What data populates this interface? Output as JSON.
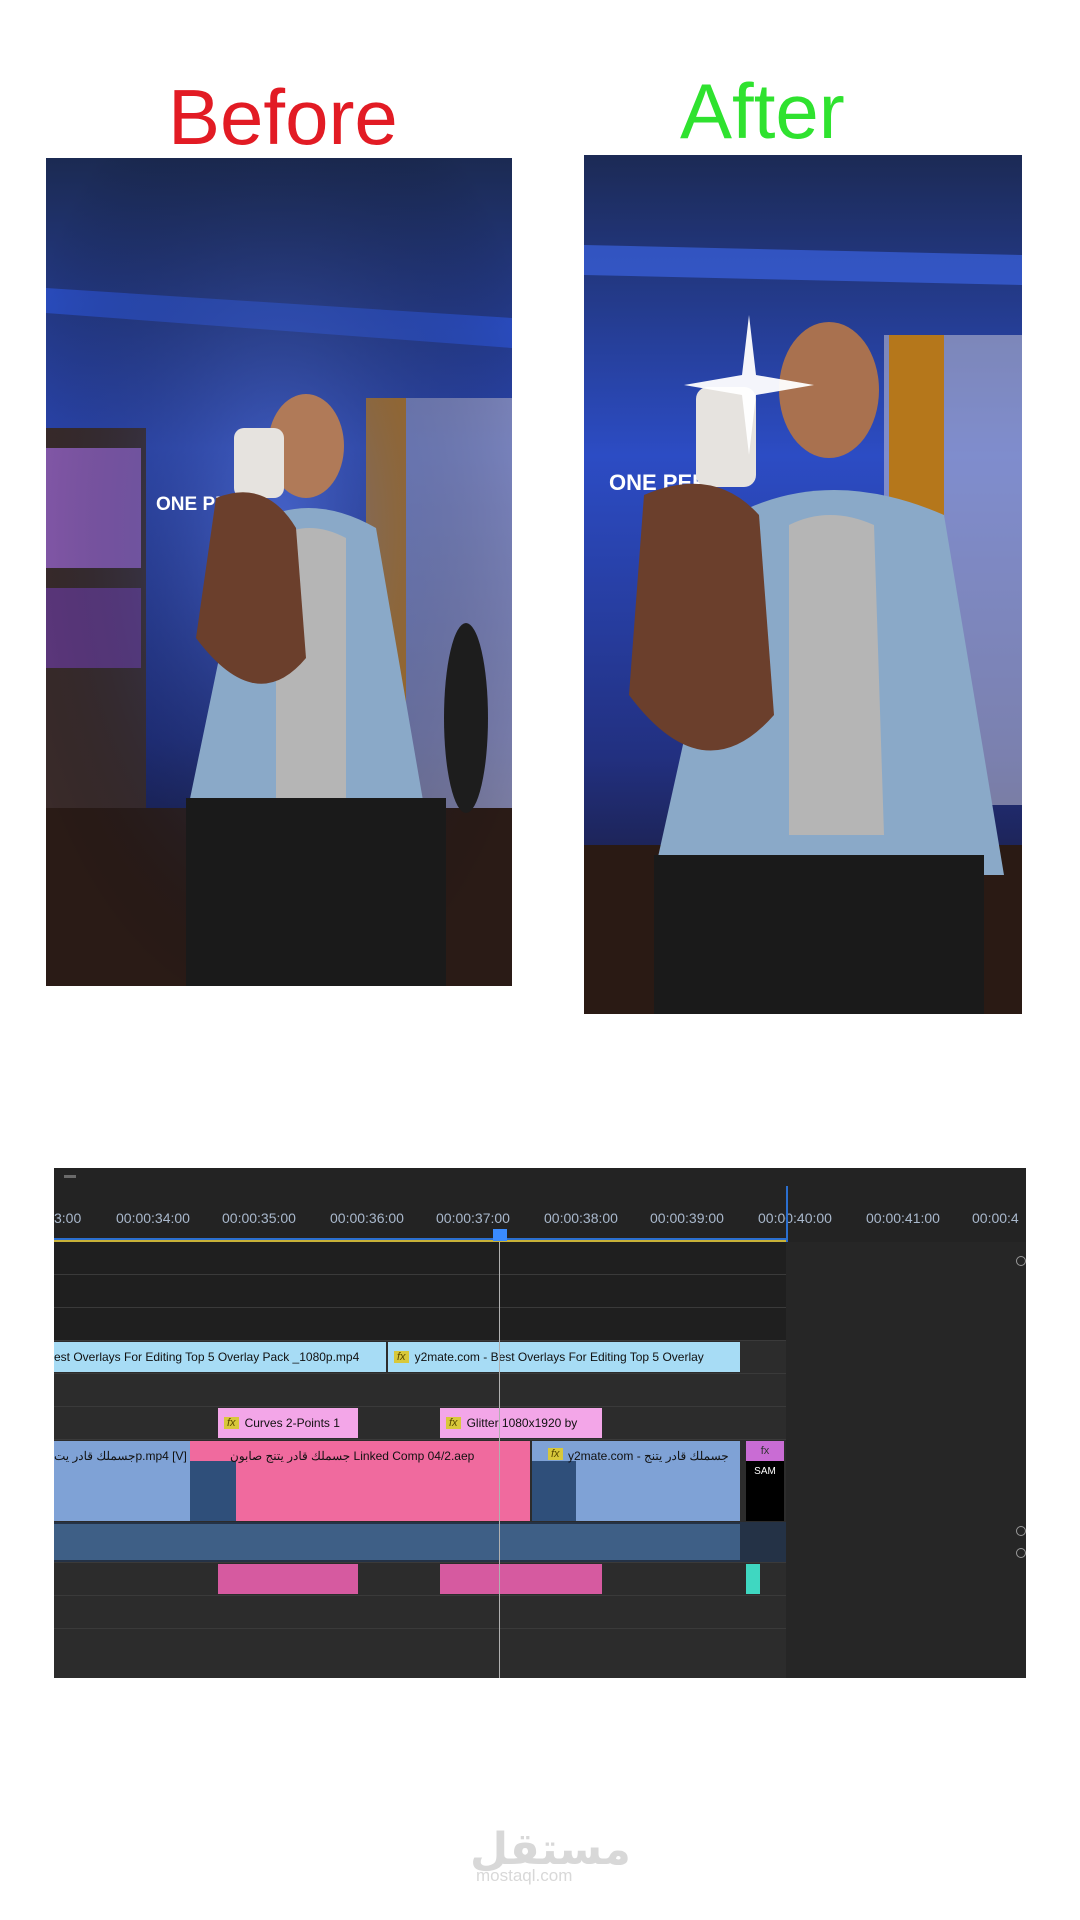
{
  "before": {
    "title": "Before",
    "color": "#e21b24"
  },
  "after": {
    "title": "After",
    "color": "#2fe22f"
  },
  "scene": {
    "neon_sign": "ONE PER"
  },
  "timeline": {
    "ruler_labels": [
      "3:00",
      "00:00:34:00",
      "00:00:35:00",
      "00:00:36:00",
      "00:00:37:00",
      "00:00:38:00",
      "00:00:39:00",
      "00:00:40:00",
      "00:00:41:00",
      "00:00:4"
    ],
    "clips": {
      "overlay1": "est Overlays For Editing  Top 5 Overlay Pack  _1080p.mp4",
      "overlay2": "y2mate.com - Best Overlays For Editing  Top 5 Overlay",
      "curves": "Curves 2-Points 1",
      "glitter": "Glitter 1080x1920 by",
      "video1": "جسملك قادر يتp.mp4 [V]",
      "linked_comp": "جسملك قادر يتنج صابون Linked Comp 04/2.aep",
      "video3": "y2mate.com - جسملك قادر يتنج",
      "sam": "SAM",
      "fx_label": "fx"
    },
    "colors": {
      "overlay": "#a7dcf5",
      "effect": "#f3a6e8",
      "video": "#7fa2d6",
      "comp": "#f06a9e",
      "audio": "#3e5f86",
      "audio_pink": "#d65aa0",
      "audio_teal": "#3fd7c1"
    }
  },
  "watermark": {
    "logo": "مستقل",
    "url": "mostaql.com"
  }
}
